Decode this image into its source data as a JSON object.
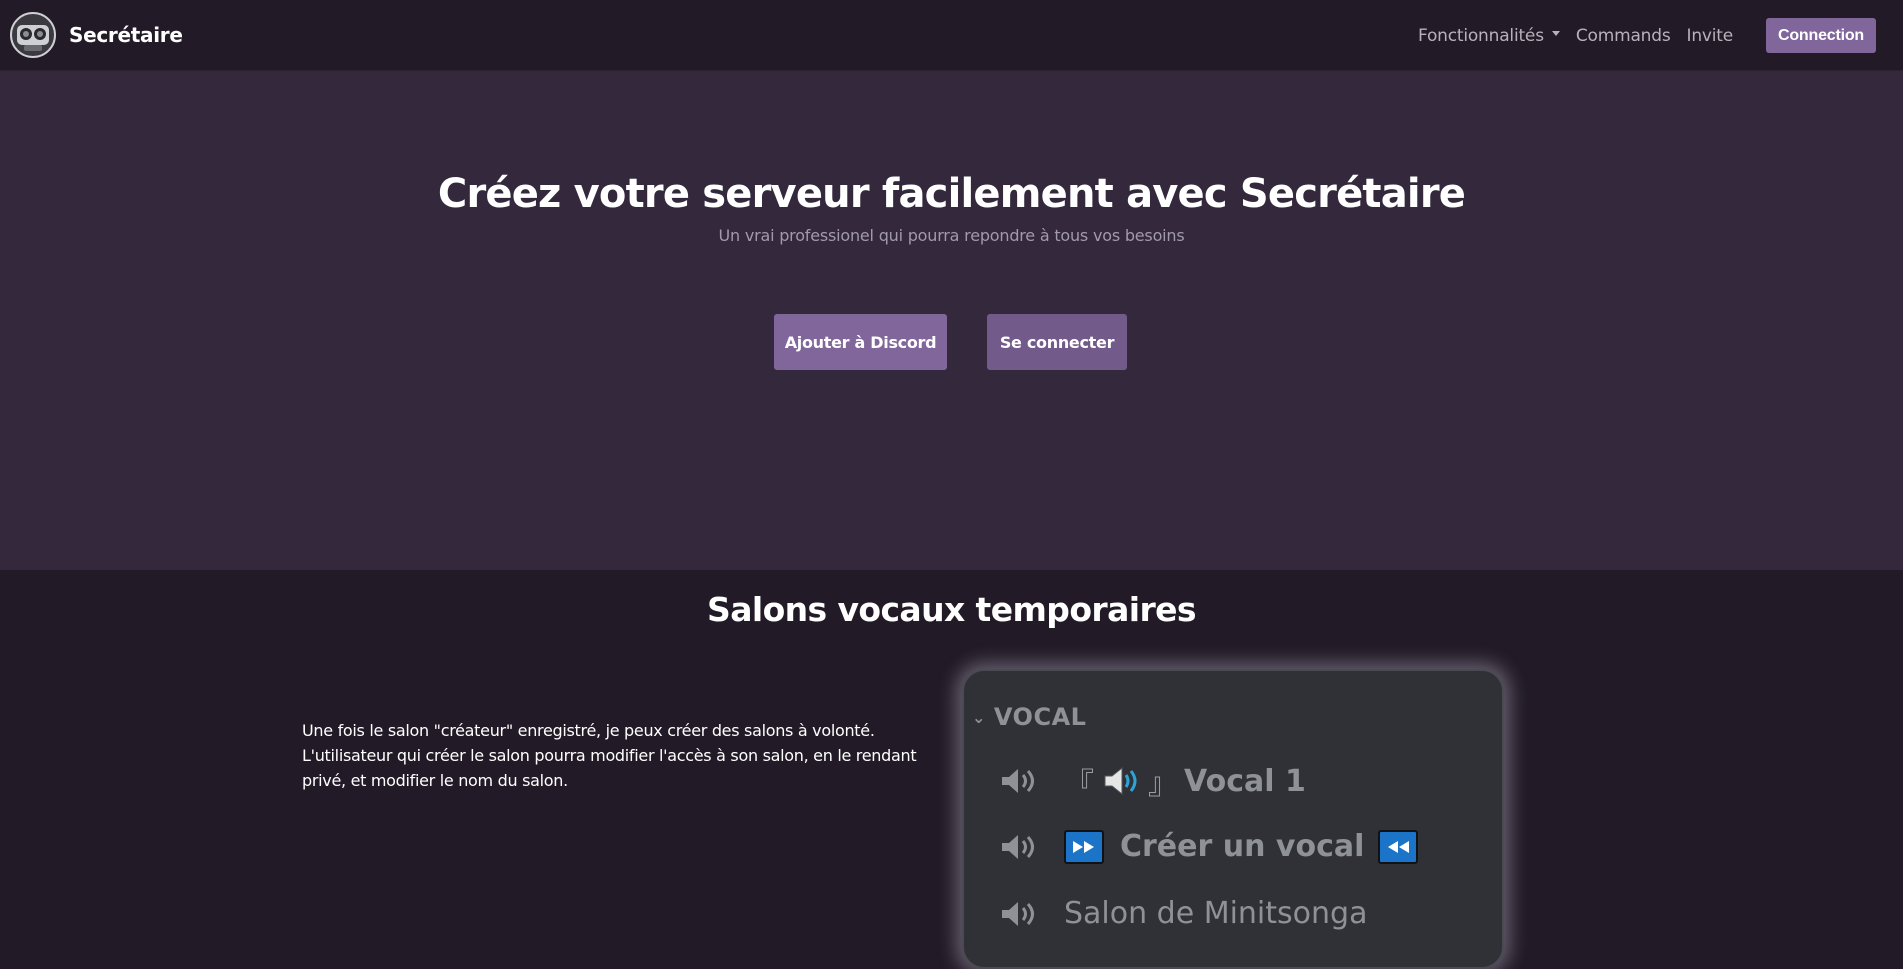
{
  "navbar": {
    "brand": "Secrétaire",
    "links": [
      {
        "label": "Fonctionnalités",
        "dropdown": true
      },
      {
        "label": "Commands"
      },
      {
        "label": "Invite"
      }
    ],
    "connection_label": "Connection"
  },
  "hero": {
    "title": "Créez votre serveur facilement avec Secrétaire",
    "subtitle": "Un vrai professionel qui pourra repondre à tous vos besoins",
    "add_button": "Ajouter à Discord",
    "login_button": "Se connecter"
  },
  "feature": {
    "title": "Salons vocaux temporaires",
    "lines": [
      "Une fois le salon \"créateur\" enregistré, je peux créer des salons à volonté.",
      "L'utilisateur qui créer le salon pourra modifier l'accès à son salon, en le rendant",
      "privé, et modifier le nom du salon."
    ]
  },
  "discord_preview": {
    "category": "VOCAL",
    "channels": [
      {
        "open": "『",
        "name": "Vocal 1",
        "close": "』"
      },
      {
        "name": "Créer un vocal"
      },
      {
        "name": "Salon de Minitsonga"
      }
    ]
  },
  "colors": {
    "navbar_bg": "#221b27",
    "hero_bg": "#34283d",
    "accent": "#80669a",
    "text_muted": "#a19aaa"
  }
}
